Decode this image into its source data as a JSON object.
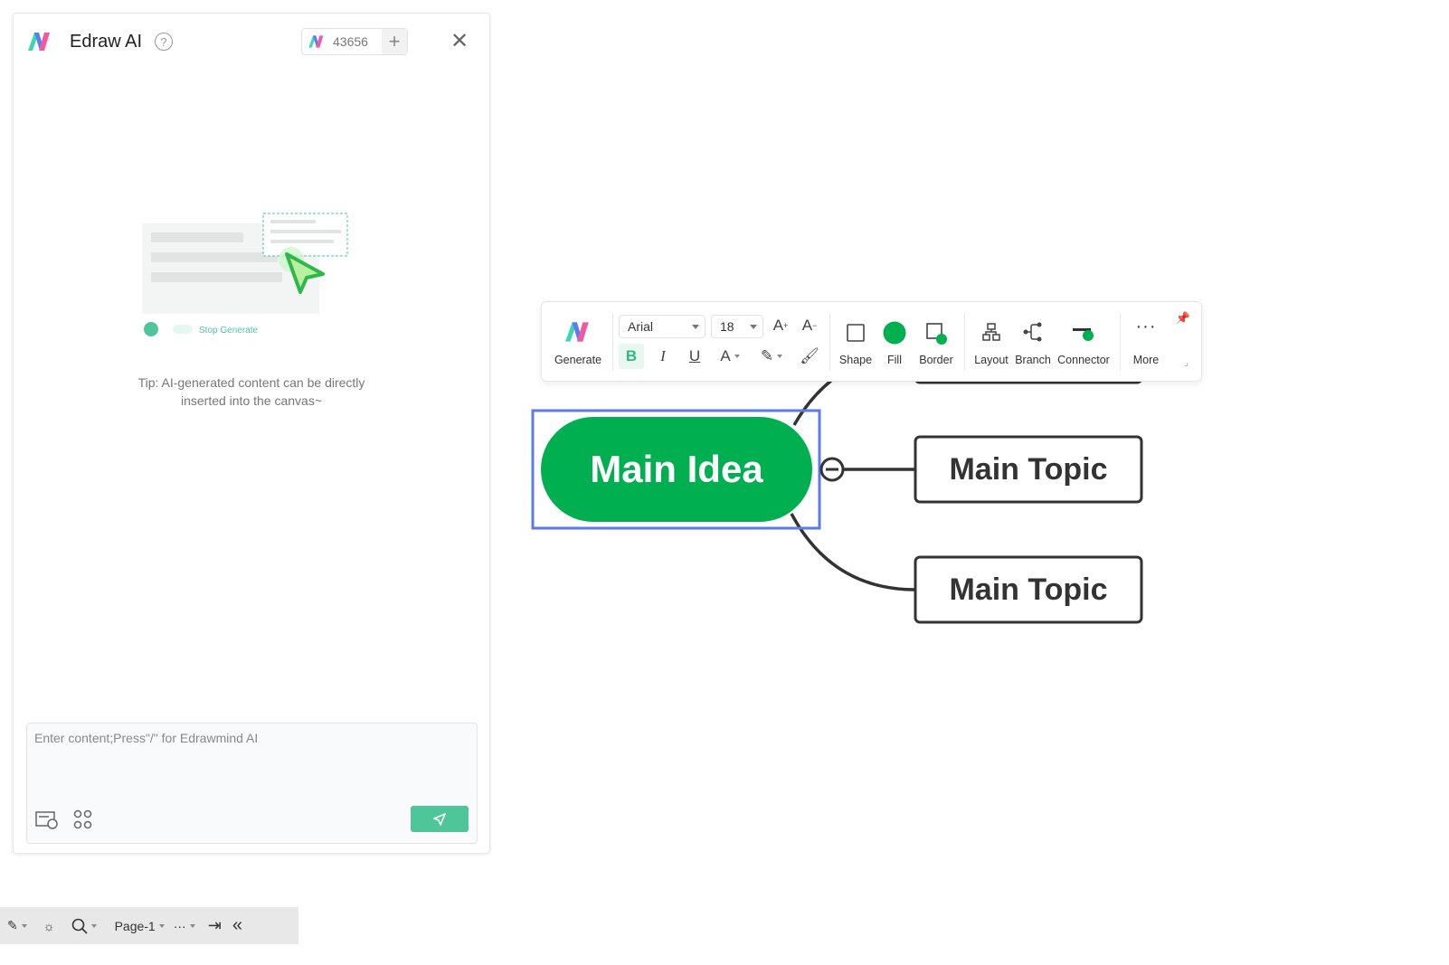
{
  "ai_panel": {
    "title": "Edraw AI",
    "help_icon": "question-circle-icon",
    "credits": "43656",
    "illustration_label": "Stop Generate",
    "tip": "Tip: AI-generated content can be directly inserted into the canvas~",
    "input_placeholder": "Enter content;Press\"/\" for Edrawmind AI",
    "accent": "#4fc59a"
  },
  "toolbar": {
    "generate": "Generate",
    "font": "Arial",
    "size": "18",
    "shape": "Shape",
    "fill": "Fill",
    "border": "Border",
    "layout": "Layout",
    "branch": "Branch",
    "connector": "Connector",
    "more": "More",
    "fill_color": "#00b050"
  },
  "mindmap": {
    "central": "Main Idea",
    "central_color": "#00b050",
    "selection_color": "#5b7be8",
    "topics": [
      "Main Topic",
      "Main Topic"
    ]
  },
  "bottombar": {
    "page": "Page-1"
  }
}
